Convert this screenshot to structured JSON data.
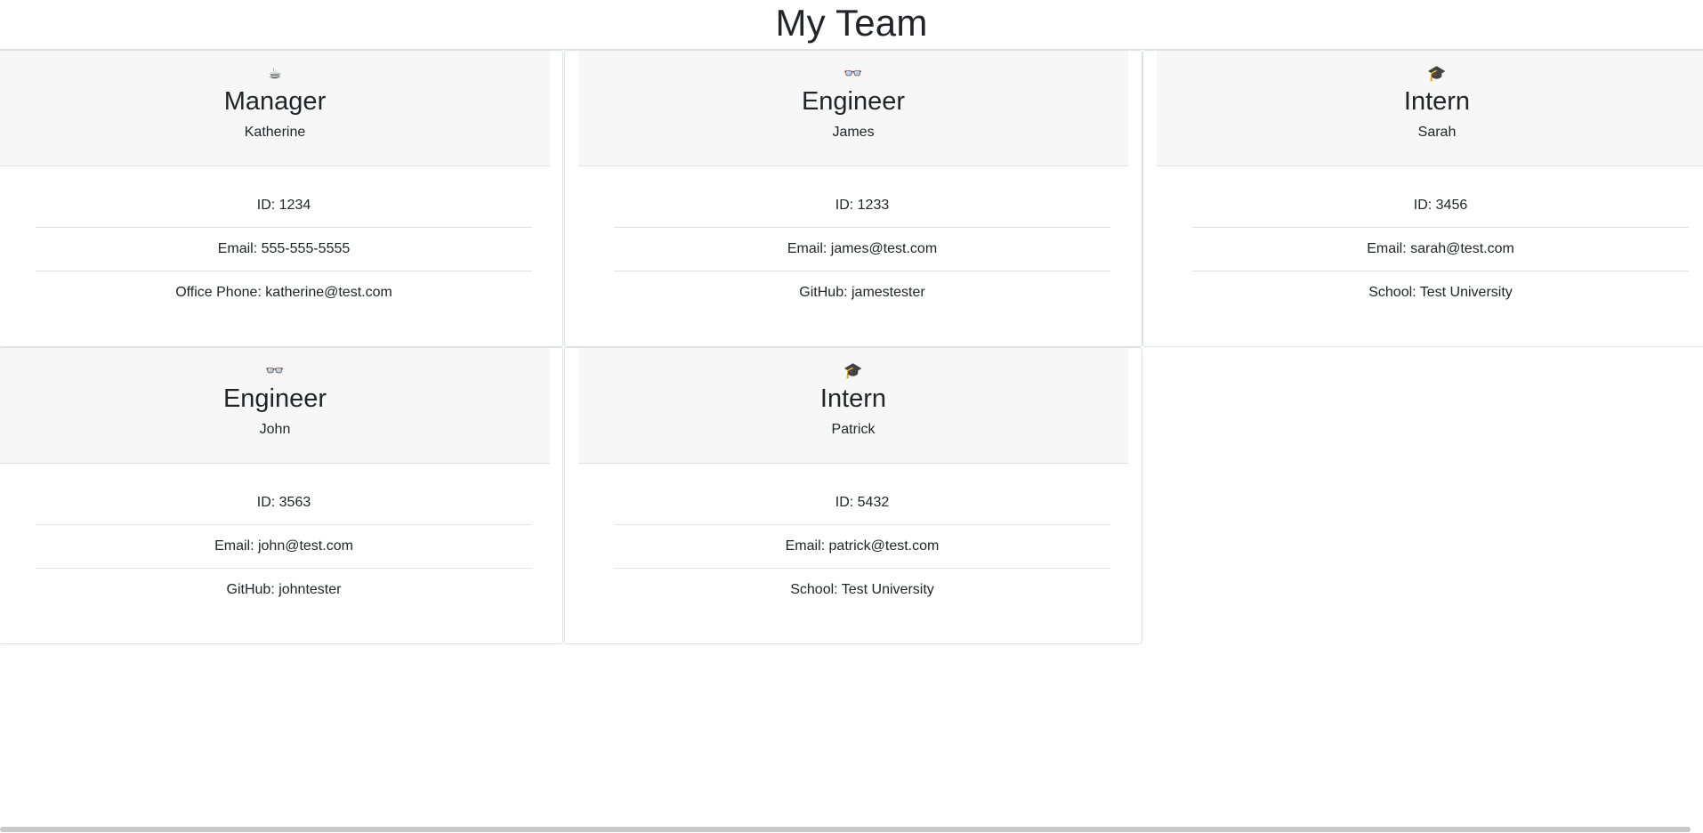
{
  "page": {
    "title": "My Team"
  },
  "cards": [
    {
      "icon": "☕",
      "icon_name": "coffee-icon",
      "role": "Manager",
      "name": "Katherine",
      "items": [
        "ID: 1234",
        "Email: 555-555-5555",
        "Office Phone: katherine@test.com"
      ]
    },
    {
      "icon": "👓",
      "icon_name": "glasses-icon",
      "role": "Engineer",
      "name": "James",
      "items": [
        "ID: 1233",
        "Email: james@test.com",
        "GitHub: jamestester"
      ]
    },
    {
      "icon": "🎓",
      "icon_name": "graduation-cap-icon",
      "role": "Intern",
      "name": "Sarah",
      "items": [
        "ID: 3456",
        "Email: sarah@test.com",
        "School: Test University"
      ]
    },
    {
      "icon": "👓",
      "icon_name": "glasses-icon",
      "role": "Engineer",
      "name": "John",
      "items": [
        "ID: 3563",
        "Email: john@test.com",
        "GitHub: johntester"
      ]
    },
    {
      "icon": "🎓",
      "icon_name": "graduation-cap-icon",
      "role": "Intern",
      "name": "Patrick",
      "items": [
        "ID: 5432",
        "Email: patrick@test.com",
        "School: Test University"
      ]
    }
  ]
}
